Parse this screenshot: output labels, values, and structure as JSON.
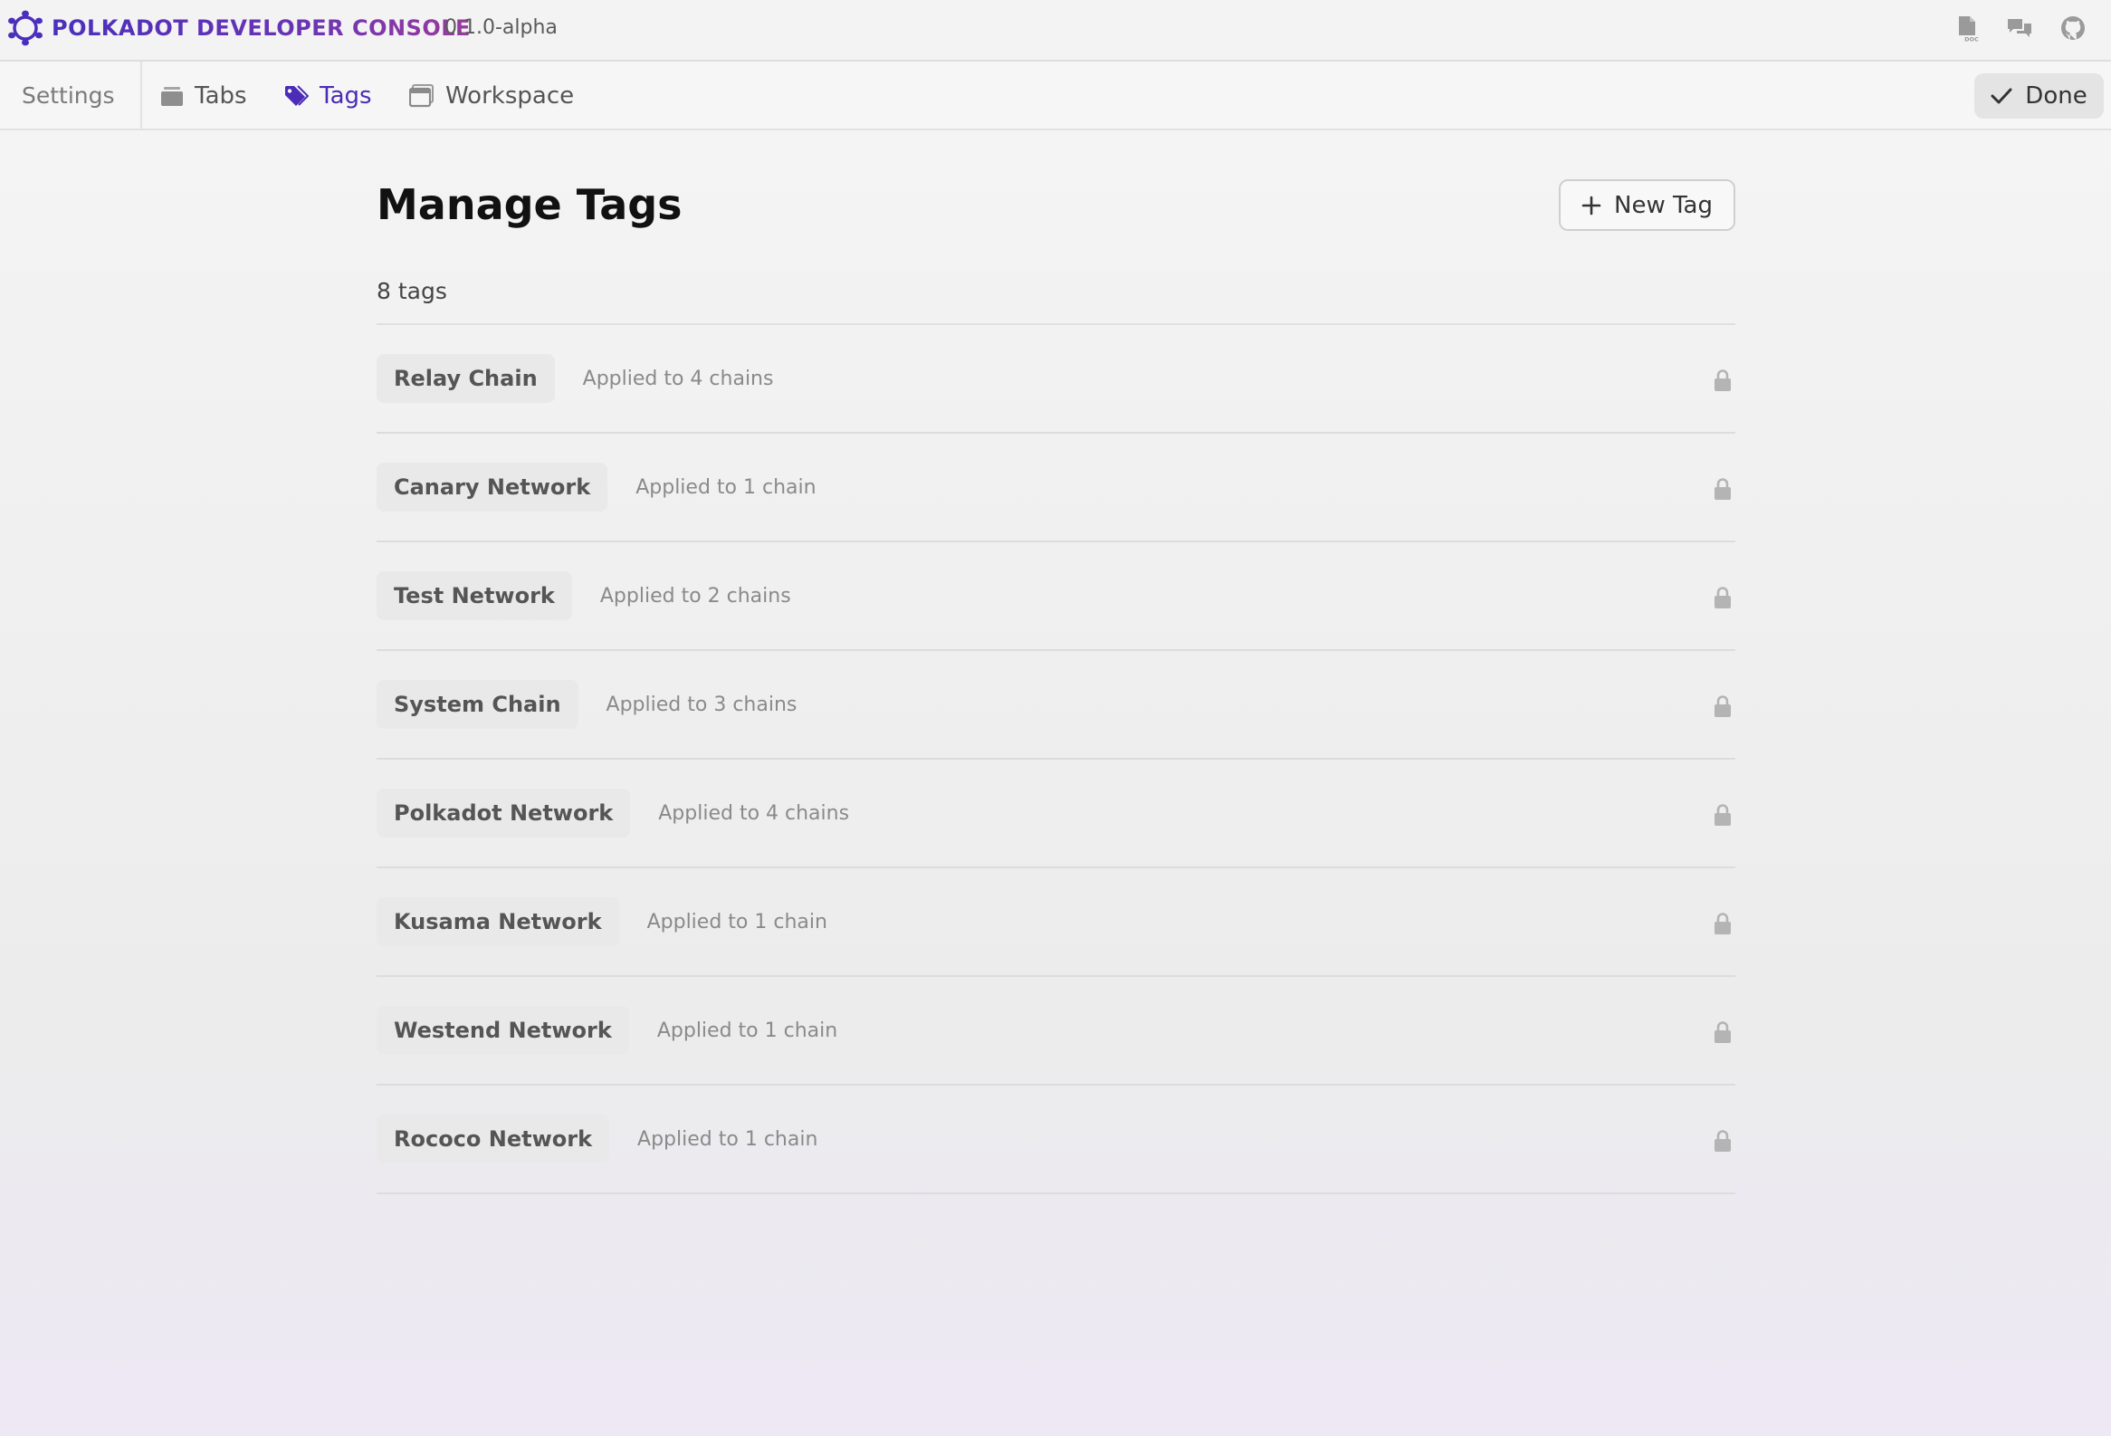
{
  "app": {
    "title": "POLKADOT DEVELOPER CONSOLE",
    "version": "0.1.0-alpha",
    "header_icons": [
      "docs-icon",
      "chat-icon",
      "github-icon"
    ]
  },
  "tabbar": {
    "settings_label": "Settings",
    "tabs": [
      {
        "label": "Tabs",
        "icon": "folder-icon",
        "active": false
      },
      {
        "label": "Tags",
        "icon": "tag-icon",
        "active": true
      },
      {
        "label": "Workspace",
        "icon": "window-icon",
        "active": false
      }
    ],
    "done_label": "Done"
  },
  "main": {
    "title": "Manage Tags",
    "new_tag_label": "New Tag",
    "tag_count": "8 tags",
    "tags": [
      {
        "name": "Relay Chain",
        "usage": "Applied to 4 chains",
        "locked": true
      },
      {
        "name": "Canary Network",
        "usage": "Applied to 1 chain",
        "locked": true
      },
      {
        "name": "Test Network",
        "usage": "Applied to 2 chains",
        "locked": true
      },
      {
        "name": "System Chain",
        "usage": "Applied to 3 chains",
        "locked": true
      },
      {
        "name": "Polkadot Network",
        "usage": "Applied to 4 chains",
        "locked": true
      },
      {
        "name": "Kusama Network",
        "usage": "Applied to 1 chain",
        "locked": true
      },
      {
        "name": "Westend Network",
        "usage": "Applied to 1 chain",
        "locked": true
      },
      {
        "name": "Rococo Network",
        "usage": "Applied to 1 chain",
        "locked": true
      }
    ]
  },
  "colors": {
    "accent": "#4b2bb8",
    "brand_gradient_start": "#4a2fbd",
    "brand_gradient_end": "#9a3a9e",
    "muted_text": "#8a8a8a",
    "chip_bg": "#e9e9e9"
  }
}
